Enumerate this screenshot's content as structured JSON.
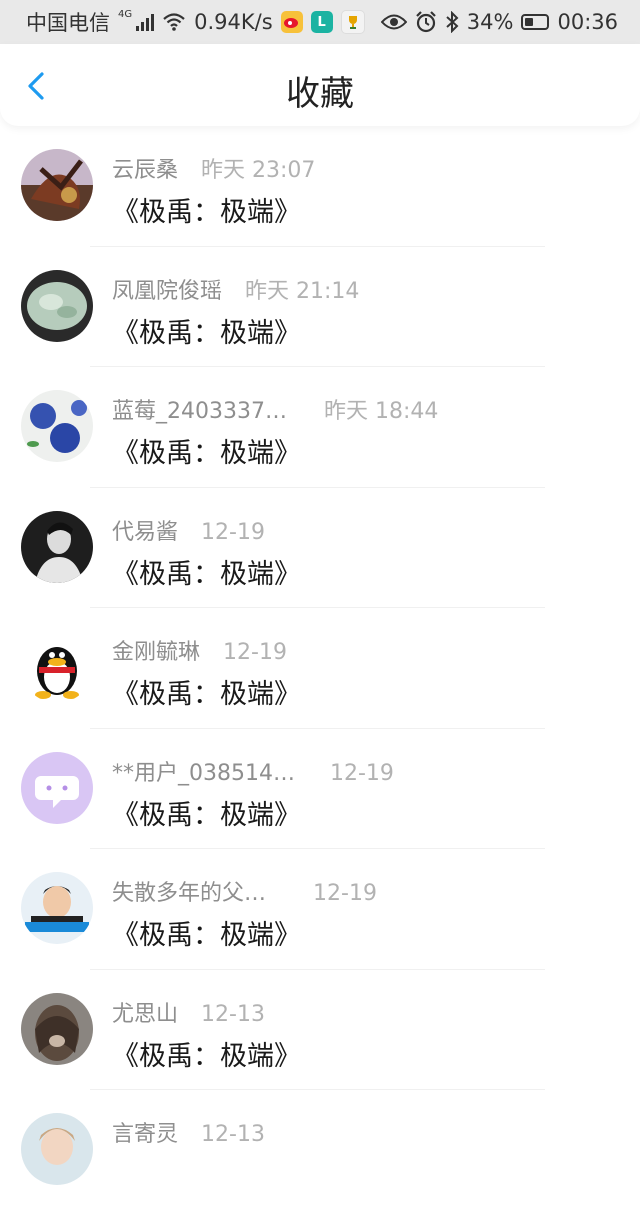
{
  "status_bar": {
    "carrier": "中国电信",
    "network_badge": "4G",
    "speed": "0.94K/s",
    "battery": "34%",
    "time": "00:36"
  },
  "nav": {
    "title": "收藏",
    "back_icon": "chevron-left-icon"
  },
  "items": [
    {
      "user": "云辰桑",
      "time": "昨天 23:07",
      "title": "《极禹：极端》",
      "avatar": "fantasy-art"
    },
    {
      "user": "凤凰院俊瑶",
      "time": "昨天 21:14",
      "title": "《极禹：极端》",
      "avatar": "jade"
    },
    {
      "user": "蓝莓_2403337…",
      "time": "昨天 18:44",
      "title": "《极禹：极端》",
      "avatar": "blueberries"
    },
    {
      "user": "代易酱",
      "time": "12-19",
      "title": "《极禹：极端》",
      "avatar": "bw-portrait"
    },
    {
      "user": "金刚毓琳",
      "time": "12-19",
      "title": "《极禹：极端》",
      "avatar": "qq-penguin"
    },
    {
      "user": "**用户_038514…",
      "time": "12-19",
      "title": "《极禹：极端》",
      "avatar": "chat-bubble"
    },
    {
      "user": "失散多年的父…",
      "time": "12-19",
      "title": "《极禹：极端》",
      "avatar": "child-photo"
    },
    {
      "user": "尤思山",
      "time": "12-13",
      "title": "《极禹：极端》",
      "avatar": "hair-photo"
    },
    {
      "user": "言寄灵",
      "time": "12-13",
      "title": "",
      "avatar": "portrait"
    }
  ]
}
